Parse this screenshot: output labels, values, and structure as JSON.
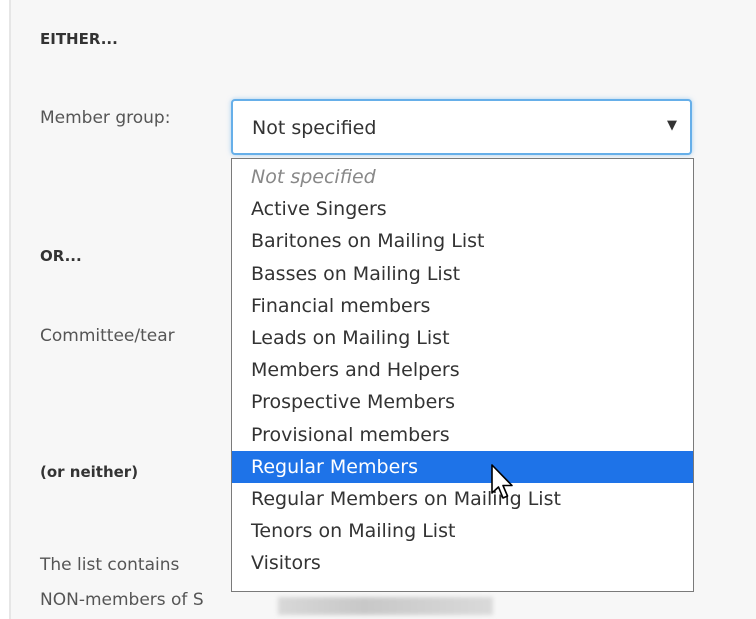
{
  "form": {
    "either_heading": "EITHER...",
    "member_group_label": "Member group:",
    "or_heading": "OR...",
    "committee_label": "Committee/tear",
    "neither_heading": "(or neither)",
    "note_line1": "The list contains",
    "note_line2": "NON-members of S"
  },
  "member_group_select": {
    "value": "Not specified",
    "arrow_icon": "caret-down-icon",
    "options": [
      "Not specified",
      "Active Singers",
      "Baritones on Mailing List",
      "Basses on Mailing List",
      "Financial members",
      "Leads on Mailing List",
      "Members and Helpers",
      "Prospective Members",
      "Provisional members",
      "Regular Members",
      "Regular Members on Mailing List",
      "Tenors on Mailing List",
      "Visitors"
    ],
    "highlighted_option": "Regular Members"
  },
  "colors": {
    "highlight": "#1e73e8",
    "focus_border": "#66afe9"
  }
}
